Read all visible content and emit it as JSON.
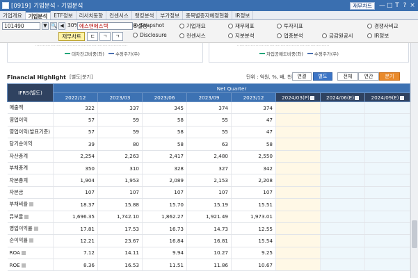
{
  "window": {
    "code": "[0919]",
    "title": "기업분석 - 기업분석",
    "badge_button": "재무차트",
    "controls": [
      "—",
      "□",
      "T",
      "?",
      "×"
    ]
  },
  "tabs": [
    "기업개요",
    "기업분석",
    "ETF정보",
    "리서치동향",
    "컨센서스",
    "랭킹분석",
    "부가정보",
    "종목별증자예정현황",
    "IR정보"
  ],
  "active_tab": "기업분석",
  "toolbar": {
    "stock_code": "101490",
    "percent": "30%",
    "stock_name": "에스앤에스텍",
    "settings_label": "설정",
    "finance_chart_button": "재무차트",
    "icon_search": "🔍",
    "icon_mic": "◀",
    "icon_down": "▼",
    "radios": [
      {
        "label": "Snapshot",
        "on": true
      },
      {
        "label": "기업개요",
        "on": false
      },
      {
        "label": "재무제표",
        "on": false
      },
      {
        "label": "투자지표",
        "on": false
      },
      {
        "label": "경쟁사비교",
        "on": false
      },
      {
        "label": "Disclosure",
        "on": false
      },
      {
        "label": "컨센서스",
        "on": false
      },
      {
        "label": "지분분석",
        "on": false
      },
      {
        "label": "업종분석",
        "on": false
      },
      {
        "label": "금감원공시",
        "on": false
      },
      {
        "label": "IR정보",
        "on": false
      }
    ]
  },
  "charts_strip": {
    "left_legend": [
      {
        "label": "대차잔고비중(좌)",
        "color": "#22a57a"
      },
      {
        "label": "수정주가(우)",
        "color": "#4a6fb0"
      }
    ],
    "right_legend": [
      {
        "label": "차입공매도비중(좌)",
        "color": "#22a57a"
      },
      {
        "label": "수정주가(우)",
        "color": "#4a6fb0"
      }
    ]
  },
  "financial_highlight": {
    "title": "Financial Highlight",
    "subtitle": "[별도|분기]",
    "unit": "단위 : 억원, %, 배, 천주",
    "toggle_left": [
      "연결",
      "별도"
    ],
    "toggle_left_active": "별도",
    "toggle_right": [
      "전체",
      "연간",
      "분기"
    ],
    "toggle_right_active": "분기",
    "header_group": "Net Quarter",
    "header_label": "IFRS(별도)",
    "columns": [
      "2022/12",
      "2023/03",
      "2023/06",
      "2023/09",
      "2023/12",
      "2024/03(P)",
      "2024/06(E)",
      "2024/09(E)"
    ],
    "rows": [
      {
        "label": "매출액",
        "q": false,
        "values": [
          "322",
          "337",
          "345",
          "374",
          "374",
          "",
          "",
          ""
        ]
      },
      {
        "label": "영업이익",
        "q": false,
        "values": [
          "57",
          "59",
          "58",
          "55",
          "47",
          "",
          "",
          ""
        ]
      },
      {
        "label": "영업이익(발표기준)",
        "q": false,
        "values": [
          "57",
          "59",
          "58",
          "55",
          "47",
          "",
          "",
          ""
        ]
      },
      {
        "label": "당기순이익",
        "q": false,
        "values": [
          "39",
          "80",
          "58",
          "63",
          "58",
          "",
          "",
          ""
        ]
      },
      {
        "label": "자산총계",
        "q": false,
        "values": [
          "2,254",
          "2,263",
          "2,417",
          "2,480",
          "2,550",
          "",
          "",
          ""
        ]
      },
      {
        "label": "부채총계",
        "q": false,
        "values": [
          "350",
          "310",
          "328",
          "327",
          "342",
          "",
          "",
          ""
        ]
      },
      {
        "label": "자본총계",
        "q": false,
        "values": [
          "1,904",
          "1,953",
          "2,089",
          "2,153",
          "2,208",
          "",
          "",
          ""
        ]
      },
      {
        "label": "자본금",
        "q": false,
        "values": [
          "107",
          "107",
          "107",
          "107",
          "107",
          "",
          "",
          ""
        ]
      },
      {
        "label": "부채비율",
        "q": true,
        "values": [
          "18.37",
          "15.88",
          "15.70",
          "15.19",
          "15.51",
          "",
          "",
          ""
        ]
      },
      {
        "label": "유보율",
        "q": true,
        "values": [
          "1,696.35",
          "1,742.10",
          "1,862.27",
          "1,921.49",
          "1,973.01",
          "",
          "",
          ""
        ]
      },
      {
        "label": "영업이익률",
        "q": true,
        "values": [
          "17.81",
          "17.53",
          "16.73",
          "14.73",
          "12.55",
          "",
          "",
          ""
        ]
      },
      {
        "label": "순이익률",
        "q": true,
        "values": [
          "12.21",
          "23.67",
          "16.84",
          "16.81",
          "15.54",
          "",
          "",
          ""
        ]
      },
      {
        "label": "ROA",
        "q": true,
        "values": [
          "7.12",
          "14.11",
          "9.94",
          "10.27",
          "9.25",
          "",
          "",
          ""
        ]
      },
      {
        "label": "ROE",
        "q": true,
        "values": [
          "8.36",
          "16.53",
          "11.51",
          "11.86",
          "10.67",
          "",
          "",
          ""
        ]
      }
    ]
  }
}
